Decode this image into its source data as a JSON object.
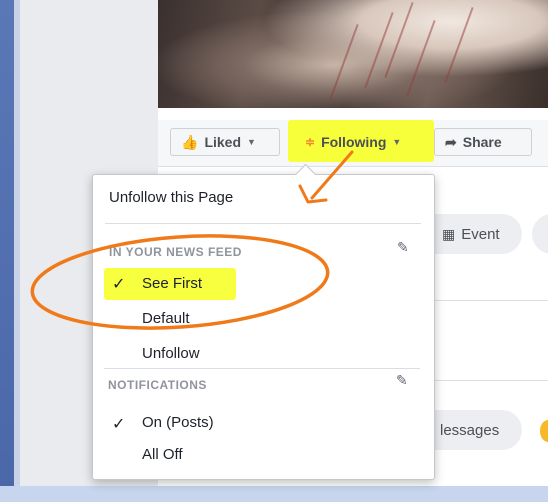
{
  "action_bar": {
    "liked_label": "Liked",
    "following_label": "Following",
    "share_label": "Share"
  },
  "background_buttons": {
    "event_label": "Event",
    "messages_label": "lessages"
  },
  "dropdown": {
    "unfollow_page_label": "Unfollow this Page",
    "news_feed_header": "IN YOUR NEWS FEED",
    "news_feed_options": [
      {
        "label": "See First",
        "checked": true
      },
      {
        "label": "Default",
        "checked": false
      },
      {
        "label": "Unfollow",
        "checked": false
      }
    ],
    "notifications_header": "NOTIFICATIONS",
    "notification_options": [
      {
        "label": "On (Posts)",
        "checked": true
      },
      {
        "label": "All Off",
        "checked": false
      }
    ]
  },
  "colors": {
    "highlight_yellow": "#f6ff2a",
    "annotation_orange": "#f07a1a",
    "facebook_blue": "#4267b2"
  },
  "icons": {
    "liked": "thumbs-up-icon",
    "following": "rss-feed-icon",
    "share": "share-arrow-icon",
    "edit": "pencil-icon",
    "check": "checkmark-icon",
    "event": "calendar-icon"
  }
}
